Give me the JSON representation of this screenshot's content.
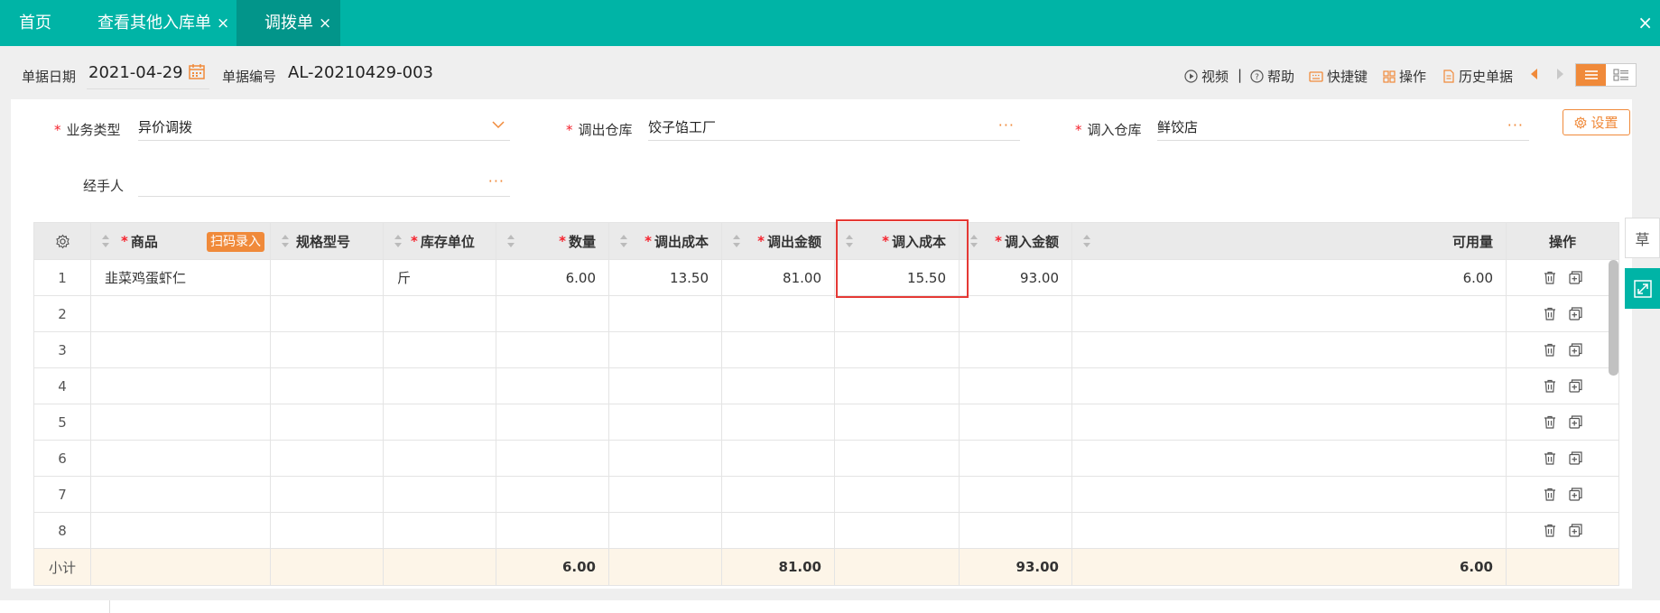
{
  "tabs": [
    {
      "label": "首页"
    },
    {
      "label": "查看其他入库单",
      "close": "×"
    },
    {
      "label": "调拨单",
      "close": "×"
    }
  ],
  "window_close": "×",
  "header": {
    "date_label": "单据日期",
    "date_value": "2021-04-29",
    "number_label": "单据编号",
    "number_value": "AL-20210429-003"
  },
  "toolbar": {
    "video": "视频",
    "separator": "|",
    "help": "帮助",
    "shortcuts": "快捷键",
    "operations": "操作",
    "history": "历史单据"
  },
  "form": {
    "business_type_label": "业务类型",
    "business_type_value": "异价调拨",
    "out_warehouse_label": "调出仓库",
    "out_warehouse_value": "饺子馅工厂",
    "in_warehouse_label": "调入仓库",
    "in_warehouse_value": "鲜饺店",
    "handler_label": "经手人",
    "handler_value": "",
    "dots": "···",
    "settings_label": "设置"
  },
  "grid": {
    "columns": {
      "product": "商品",
      "scan": "扫码录入",
      "spec": "规格型号",
      "unit": "库存单位",
      "qty": "数量",
      "out_cost": "调出成本",
      "out_amount": "调出金额",
      "in_cost": "调入成本",
      "in_amount": "调入金额",
      "available": "可用量",
      "ops": "操作"
    },
    "rows": [
      {
        "idx": "1",
        "product": "韭菜鸡蛋虾仁",
        "spec": "",
        "unit": "斤",
        "qty": "6.00",
        "out_cost": "13.50",
        "out_amount": "81.00",
        "in_cost": "15.50",
        "in_amount": "93.00",
        "available": "6.00"
      },
      {
        "idx": "2"
      },
      {
        "idx": "3"
      },
      {
        "idx": "4"
      },
      {
        "idx": "5"
      },
      {
        "idx": "6"
      },
      {
        "idx": "7"
      },
      {
        "idx": "8"
      }
    ],
    "subtotal": {
      "label": "小计",
      "qty": "6.00",
      "out_amount": "81.00",
      "in_amount": "93.00",
      "available": "6.00"
    }
  },
  "side": {
    "draft_label": "草"
  },
  "colors": {
    "teal": "#00b4a6",
    "teal_dark": "#02958a",
    "orange": "#f08a3a",
    "required": "#f5222d",
    "highlight": "#e53935",
    "subtotal_bg": "#fdf5e8"
  }
}
